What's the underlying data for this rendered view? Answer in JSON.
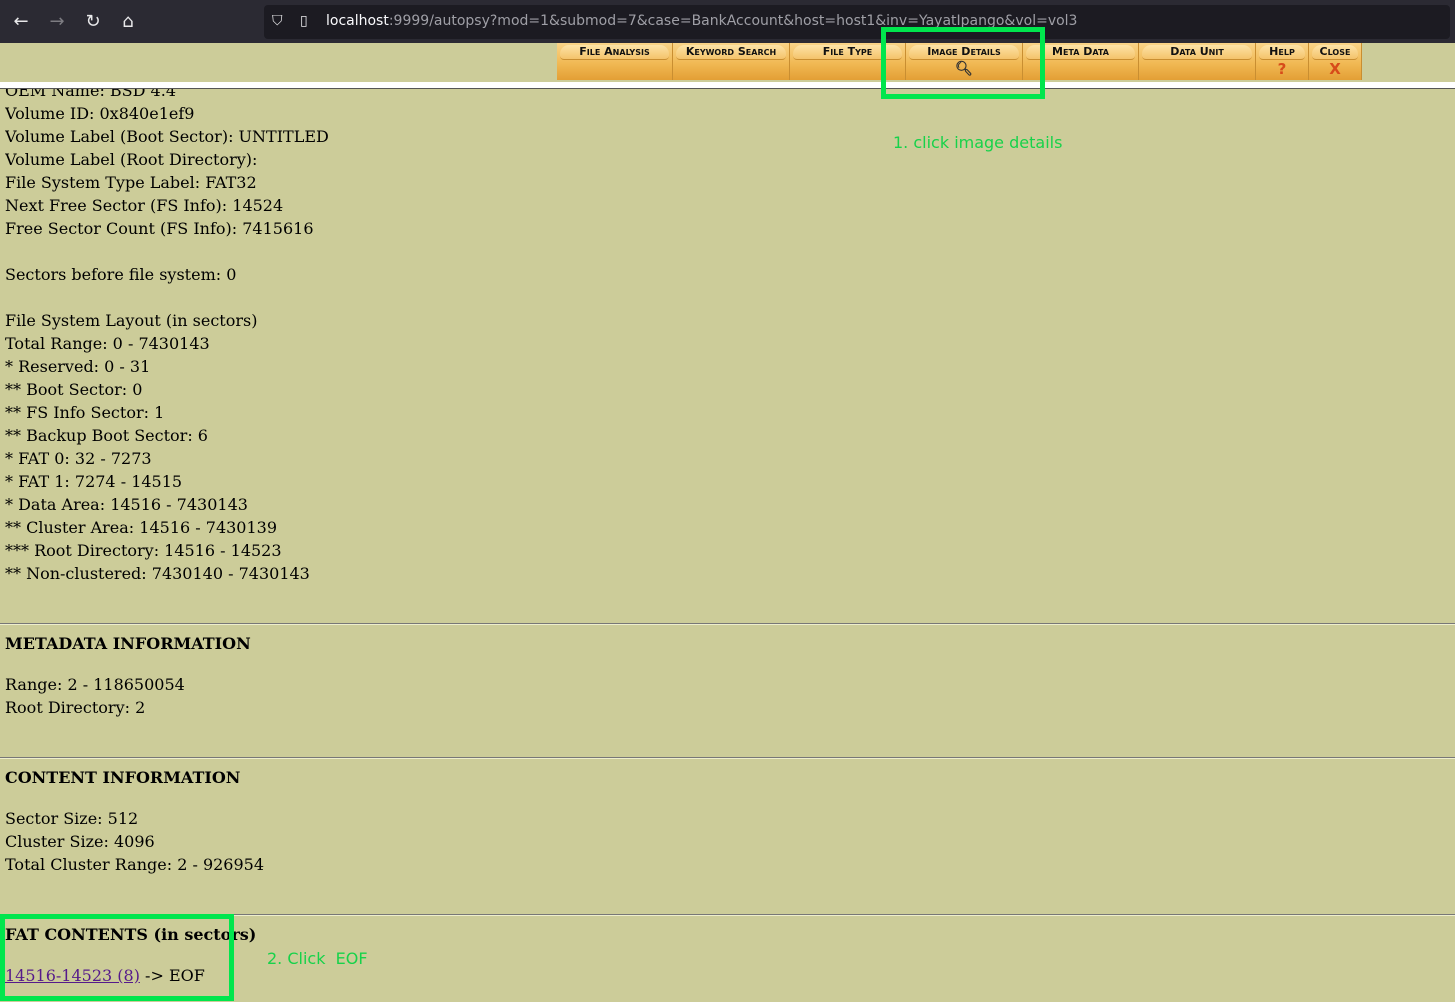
{
  "browser": {
    "url_host": "localhost",
    "url_rest": ":9999/autopsy?mod=1&submod=7&case=BankAccount&host=host1&inv=YayatIpango&vol=vol3"
  },
  "toolbar": {
    "buttons": [
      {
        "label": "File Analysis",
        "sub": ""
      },
      {
        "label": "Keyword Search",
        "sub": ""
      },
      {
        "label": "File Type",
        "sub": ""
      },
      {
        "label": "Image Details",
        "sub": ""
      },
      {
        "label": "Meta Data",
        "sub": ""
      },
      {
        "label": "Data Unit",
        "sub": ""
      },
      {
        "label": "Help",
        "sub": "?"
      },
      {
        "label": "Close",
        "sub": "X"
      }
    ]
  },
  "fs_info": [
    "OEM Name: BSD 4.4",
    "Volume ID: 0x840e1ef9",
    "Volume Label (Boot Sector): UNTITLED",
    "Volume Label (Root Directory):",
    "File System Type Label: FAT32",
    "Next Free Sector (FS Info): 14524",
    "Free Sector Count (FS Info): 7415616",
    "",
    "Sectors before file system: 0",
    "",
    "File System Layout (in sectors)",
    "Total Range: 0 - 7430143",
    "* Reserved: 0 - 31",
    "** Boot Sector: 0",
    "** FS Info Sector: 1",
    "** Backup Boot Sector: 6",
    "* FAT 0: 32 - 7273",
    "* FAT 1: 7274 - 14515",
    "* Data Area: 14516 - 7430143",
    "** Cluster Area: 14516 - 7430139",
    "*** Root Directory: 14516 - 14523",
    "** Non-clustered: 7430140 - 7430143"
  ],
  "metadata": {
    "title": "METADATA INFORMATION",
    "lines": [
      "Range: 2 - 118650054",
      "Root Directory: 2"
    ]
  },
  "content_info": {
    "title": "CONTENT INFORMATION",
    "lines": [
      "Sector Size: 512",
      "Cluster Size: 4096",
      "Total Cluster Range: 2 - 926954"
    ]
  },
  "fat_contents": {
    "title": "FAT CONTENTS (in sectors)",
    "link": "14516-14523 (8)",
    "suffix": " -> EOF"
  },
  "annotations": {
    "step1": "1. click image details",
    "step2": "2. Click  EOF"
  },
  "colors": {
    "page_bg": "#cccc99",
    "annotation": "#00e64d"
  }
}
